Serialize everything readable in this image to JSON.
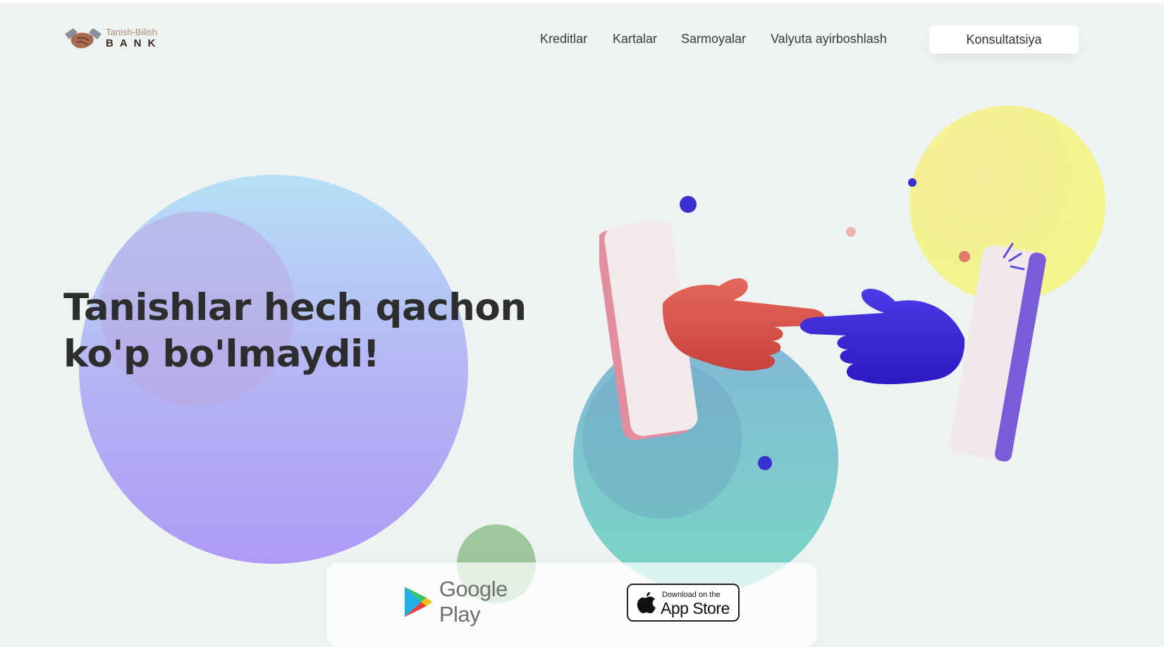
{
  "brand": {
    "tagline": "Tanish-Bilish",
    "name": "BANK"
  },
  "nav": {
    "items": [
      "Kreditlar",
      "Kartalar",
      "Sarmoyalar",
      "Valyuta ayirboshlash"
    ],
    "cta_label": "Konsultatsiya"
  },
  "hero": {
    "headline_line1": "Tanishlar hech qachon",
    "headline_line2": "ko'p bo'lmaydi!"
  },
  "stores": {
    "google_play_label": "Google Play",
    "app_store_small": "Download on the",
    "app_store_big": "App Store"
  },
  "colors": {
    "background": "#eef3f2",
    "headline": "#2d2d2d",
    "hand_left": "#d8534a",
    "hand_right": "#3a24d6",
    "phone_left": "#e890a0",
    "phone_right": "#7a5cd8"
  },
  "icons": [
    "handshake-logo-icon",
    "google-play-icon",
    "apple-icon"
  ]
}
